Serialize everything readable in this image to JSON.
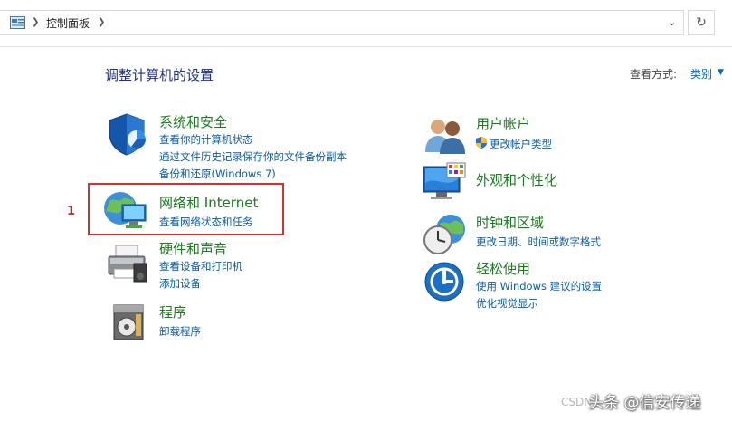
{
  "address_bar": {
    "breadcrumb": "控制面板",
    "refresh_glyph": "↻",
    "dropdown_glyph": "⌄"
  },
  "heading": "调整计算机的设置",
  "view_by": {
    "label": "查看方式:",
    "value": "类别"
  },
  "categories": [
    {
      "title": "系统和安全",
      "links": [
        "查看你的计算机状态",
        "通过文件历史记录保存你的文件备份副本",
        "备份和还原(Windows 7)"
      ],
      "icon": "shield-icon"
    },
    {
      "title": "网络和 Internet",
      "links": [
        "查看网络状态和任务"
      ],
      "icon": "network-globe-icon"
    },
    {
      "title": "硬件和声音",
      "links": [
        "查看设备和打印机",
        "添加设备"
      ],
      "icon": "printer-icon"
    },
    {
      "title": "程序",
      "links": [
        "卸载程序"
      ],
      "icon": "programs-icon"
    },
    {
      "title": "用户帐户",
      "links": [
        "更改帐户类型"
      ],
      "icon": "users-icon"
    },
    {
      "title": "外观和个性化",
      "links": [],
      "icon": "monitor-icon"
    },
    {
      "title": "时钟和区域",
      "links": [
        "更改日期、时间或数字格式"
      ],
      "icon": "clock-globe-icon"
    },
    {
      "title": "轻松使用",
      "links": [
        "使用 Windows 建议的设置",
        "优化视觉显示"
      ],
      "icon": "ease-of-access-icon"
    }
  ],
  "annotation": {
    "marker": "1",
    "color": "#d8302e"
  },
  "watermark": {
    "text": "头条 @信安传递",
    "source": "CSDN"
  },
  "colors": {
    "category_title": "#1a7a1e",
    "link": "#0a5da8",
    "heading": "#1e3287"
  }
}
